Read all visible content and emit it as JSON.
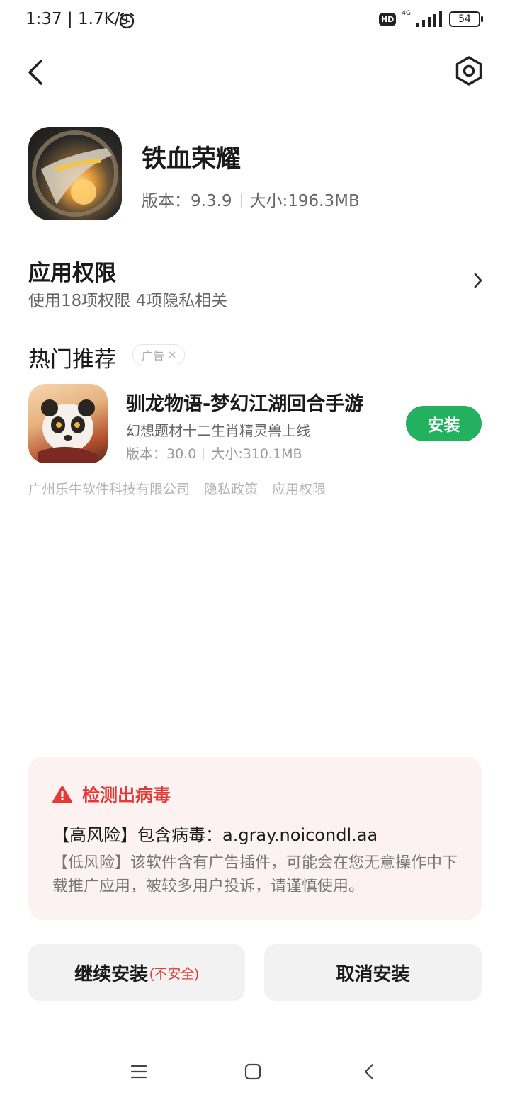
{
  "status_bar": {
    "time_speed": "1:37 | 1.7K/s",
    "hd": "HD",
    "network": "4G",
    "battery": "54"
  },
  "app": {
    "name": "铁血荣耀",
    "version": "版本：9.3.9",
    "size": "大小:196.3MB"
  },
  "permissions": {
    "title": "应用权限",
    "summary": "使用18项权限 4项隐私相关"
  },
  "recommend": {
    "section_title": "热门推荐",
    "ad_label": "广告",
    "item": {
      "name": "驯龙物语-梦幻江湖回合手游",
      "description": "幻想题材十二生肖精灵兽上线",
      "version": "版本：30.0",
      "size": "大小:310.1MB",
      "install_label": "安装"
    }
  },
  "footer": {
    "developer": "广州乐牛软件科技有限公司",
    "privacy_link": "隐私政策",
    "permission_link": "应用权限"
  },
  "warning": {
    "title": "检测出病毒",
    "high_risk": "【高风险】包含病毒：a.gray.noicondl.aa",
    "low_risk": "【低风险】该软件含有广告插件，可能会在您无意操作中下载推广应用，被较多用户投诉，请谨慎使用。"
  },
  "actions": {
    "continue_label": "继续安装",
    "continue_note": "(不安全)",
    "cancel_label": "取消安装"
  },
  "colors": {
    "accent_green": "#23b05f",
    "danger_red": "#e53935",
    "warning_bg": "#fdf2f2"
  }
}
